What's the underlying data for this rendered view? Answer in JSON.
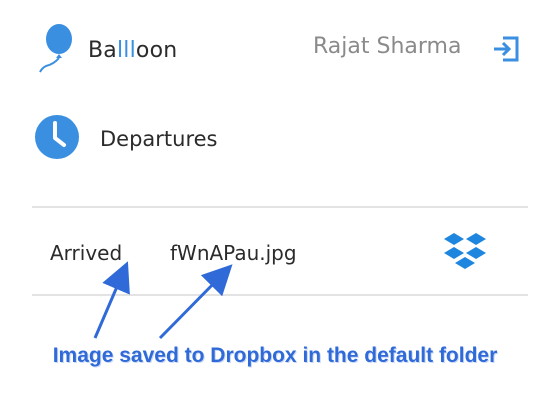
{
  "header": {
    "brand_prefix": "Ba",
    "brand_accent": "lll",
    "brand_suffix": "oon",
    "user_name": "Rajat Sharma",
    "logo_icon": "balloon-icon",
    "logout_icon": "logout-icon"
  },
  "section": {
    "label": "Departures",
    "icon": "clock-icon"
  },
  "row": {
    "status": "Arrived",
    "file_name": "fWnAPau.jpg",
    "action_icon": "dropbox-icon"
  },
  "annotation": {
    "caption": "Image saved to Dropbox in the default folder"
  },
  "colors": {
    "accent": "#3a8fe0",
    "text": "#2b2b2b",
    "muted": "#8a8a8a",
    "annotation": "#2f6ad8"
  }
}
